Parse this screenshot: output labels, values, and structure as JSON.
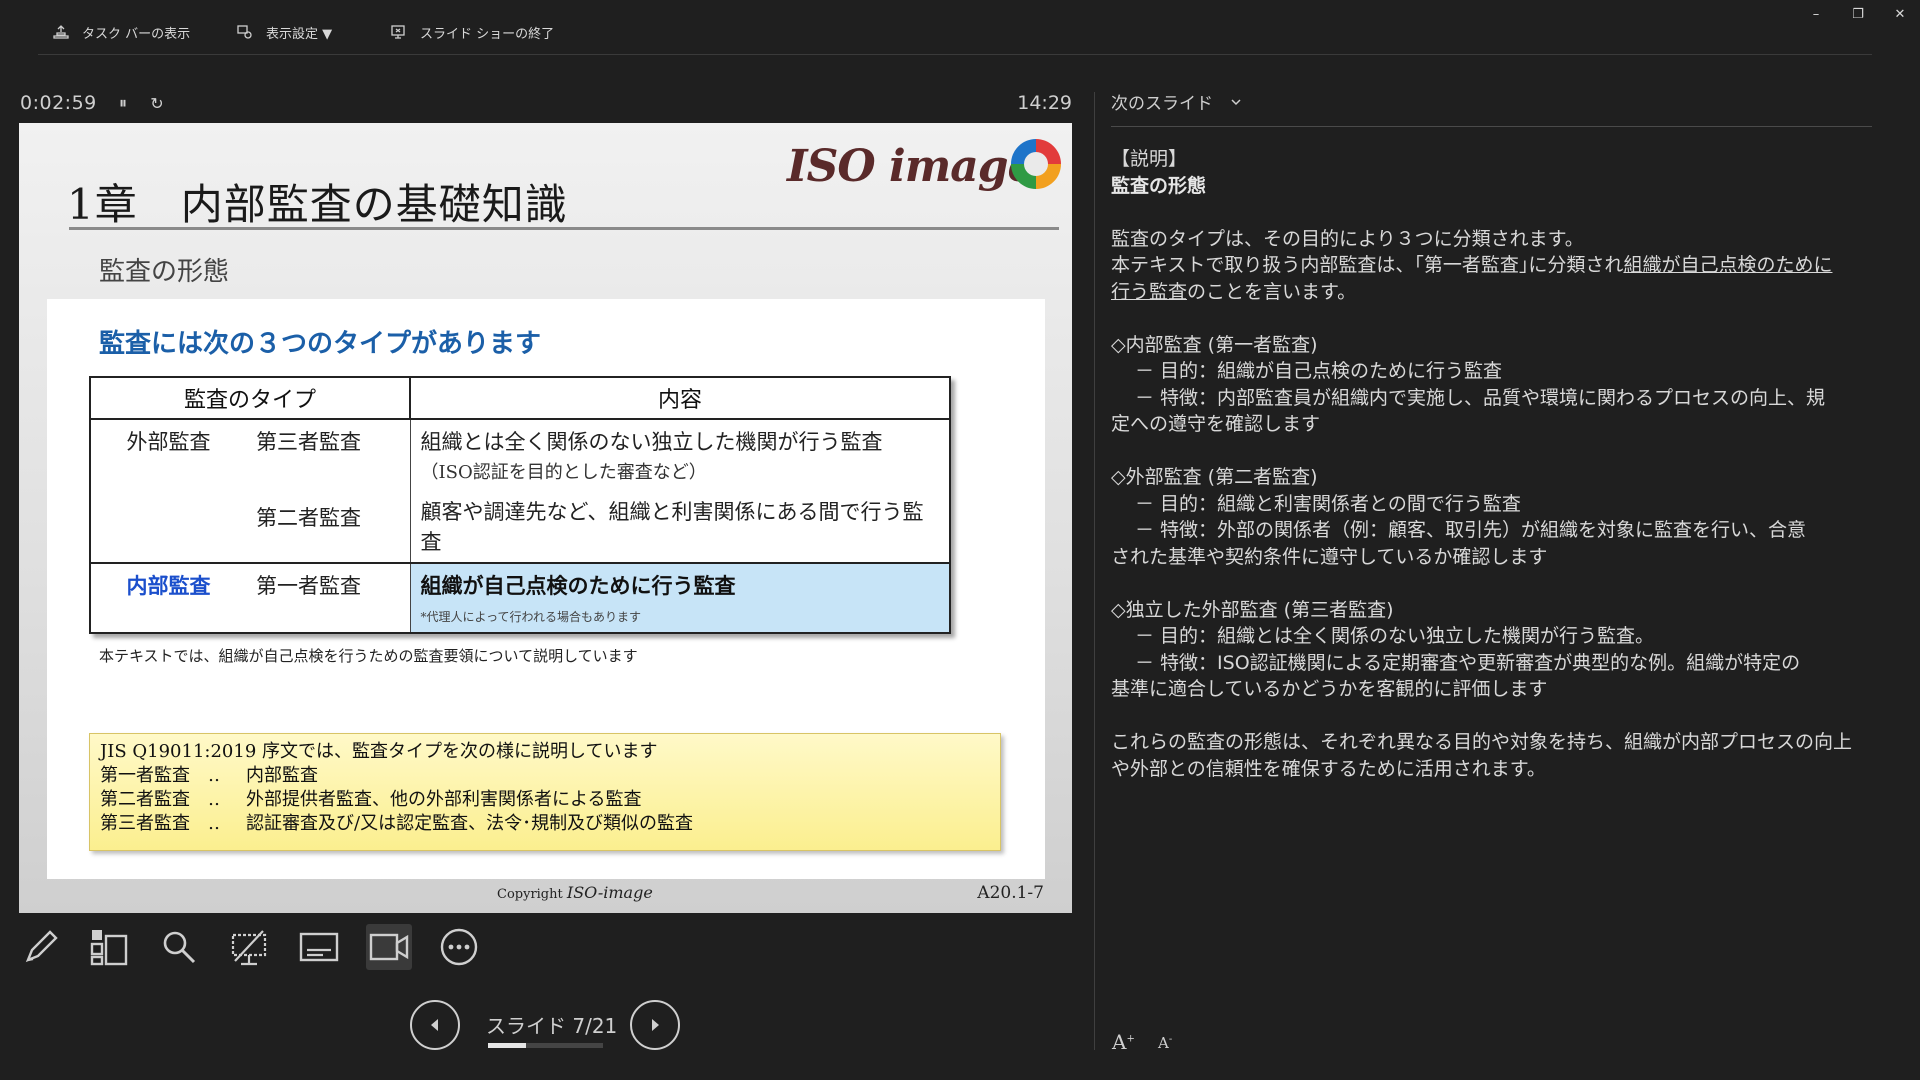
{
  "topbar": {
    "show_taskbar": "タスク バーの表示",
    "display_settings": "表示設定 ▼",
    "end_slideshow": "スライド ショーの終了",
    "minimize": "–",
    "restore": "❐",
    "close": "✕"
  },
  "presenter": {
    "timer": "0:02:59",
    "pause_icon": "⏸",
    "restart_icon": "↻",
    "clock": "14:29",
    "slide_counter": "スライド 7/21",
    "progress": 0.333
  },
  "slide": {
    "title": "1章　内部監査の基礎知識",
    "subtitle": "監査の形態",
    "logo_text": "ISO image",
    "heading": "監査には次の３つのタイプがあります",
    "table": {
      "header_type": "監査のタイプ",
      "header_content": "内容",
      "ext_label": "外部監査",
      "third_party": "第三者監査",
      "third_desc": "組織とは全く関係のない独立した機関が行う監査",
      "third_note": "（ISO認証を目的とした審査など）",
      "second_party": "第二者監査",
      "second_desc": "顧客や調達先など、組織と利害関係にある間で行う監査",
      "int_label": "内部監査",
      "first_party": "第一者監査",
      "first_desc": "組織が自己点検のために行う監査",
      "first_note": "*代理人によって行われる場合もあります"
    },
    "note_line": "本テキストでは、組織が自己点検を行うための監査要領について説明しています",
    "jis": {
      "intro": "JIS Q19011:2019 序文では、監査タイプを次の様に説明しています",
      "rows": [
        {
          "k": "第一者監査",
          "d": "‥",
          "v": "内部監査"
        },
        {
          "k": "第二者監査",
          "d": "‥",
          "v": "外部提供者監査、他の外部利害関係者による監査"
        },
        {
          "k": "第三者監査",
          "d": "‥",
          "v": "認証審査及び/又は認定監査、法令･規制及び類似の監査"
        }
      ]
    },
    "footer_copyright": "Copyright",
    "footer_logo": "ISO-image",
    "slide_code": "A20.1-7"
  },
  "notes_panel": {
    "next_slide_label": "次のスライド",
    "l1": "【説明】",
    "l2": "監査の形態",
    "l3": "監査のタイプは、その目的により３つに分類されます。",
    "l4a": "本テキストで取り扱う内部監査は、｢第一者監査｣に分類され",
    "l4b": "組織が自己点検のために",
    "l5": "行う監査",
    "l5b": "のことを言います。",
    "l6": "◇内部監査 (第一者監査)",
    "l7": "－ 目的：組織が自己点検のために行う監査",
    "l8": "－ 特徴：内部監査員が組織内で実施し、品質や環境に関わるプロセスの向上、規",
    "l9": "定への遵守を確認します",
    "l10": "◇外部監査 (第二者監査)",
    "l11": "－ 目的：組織と利害関係者との間で行う監査",
    "l12": "－ 特徴：外部の関係者（例：顧客、取引先）が組織を対象に監査を行い、合意",
    "l13": "された基準や契約条件に遵守しているか確認します",
    "l14": "◇独立した外部監査 (第三者監査)",
    "l15": "－ 目的：組織とは全く関係のない独立した機関が行う監査。",
    "l16": "－ 特徴：ISO認証機関による定期審査や更新審査が典型的な例。組織が特定の",
    "l17": "基準に適合しているかどうかを客観的に評価します",
    "l18": "これらの監査の形態は、それぞれ異なる目的や対象を持ち、組織が内部プロセスの向上",
    "l19": "や外部との信頼性を確保するために活用されます。",
    "font_up": "A",
    "font_down": "A"
  }
}
